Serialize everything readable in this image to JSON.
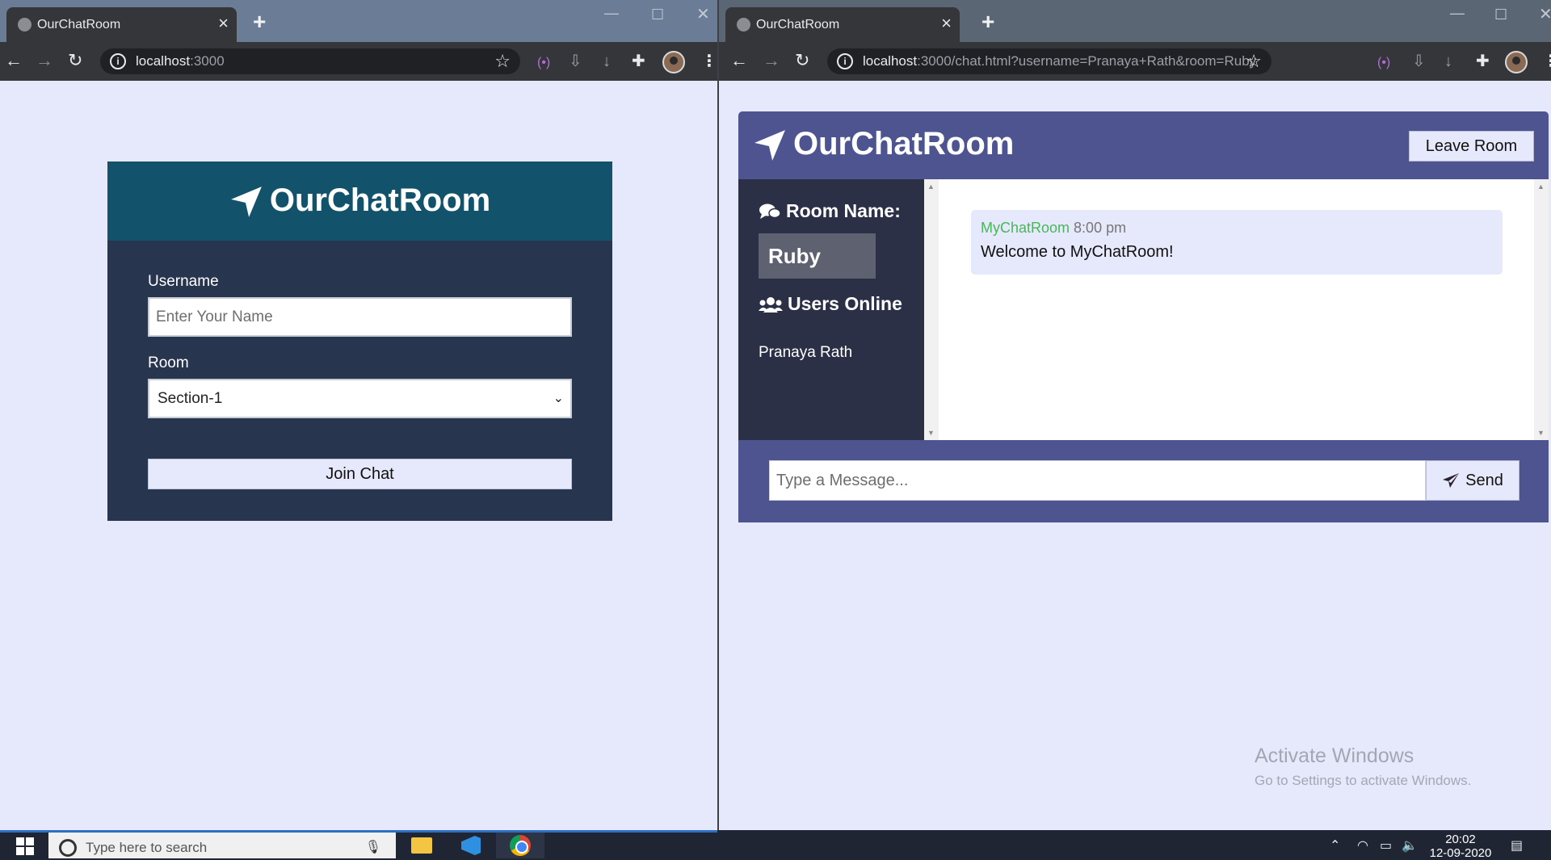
{
  "left_window": {
    "tab_title": "OurChatRoom",
    "url_host": "localhost",
    "url_rest": ":3000",
    "login": {
      "brand": "OurChatRoom",
      "username_label": "Username",
      "username_placeholder": "Enter Your Name",
      "username_value": "",
      "room_label": "Room",
      "room_selected": "Section-1",
      "join_button": "Join Chat"
    }
  },
  "right_window": {
    "tab_title": "OurChatRoom",
    "url_host": "localhost",
    "url_rest": ":3000/chat.html?username=Pranaya+Rath&room=Ruby",
    "chat": {
      "brand": "OurChatRoom",
      "leave_button": "Leave Room",
      "room_name_label": "Room Name:",
      "room_name": "Ruby",
      "users_label": "Users Online",
      "users": [
        "Pranaya Rath"
      ],
      "messages": [
        {
          "user": "MyChatRoom",
          "time": "8:00 pm",
          "text": "Welcome to MyChatRoom!"
        }
      ],
      "message_placeholder": "Type a Message...",
      "message_value": "",
      "send_button": "Send"
    },
    "watermark": {
      "line1": "Activate Windows",
      "line2": "Go to Settings to activate Windows."
    }
  },
  "taskbar": {
    "search_placeholder": "Type here to search",
    "time": "20:02",
    "date": "12-09-2020",
    "pinned_apps": [
      "file-explorer",
      "visual-studio-code",
      "google-chrome"
    ]
  },
  "colors": {
    "page_bg": "#e6e9fb",
    "login_header": "#12536b",
    "login_body": "#28354f",
    "chat_header": "#4d5490",
    "chat_sidebar": "#2c3047",
    "username_accent": "#49b65a"
  }
}
